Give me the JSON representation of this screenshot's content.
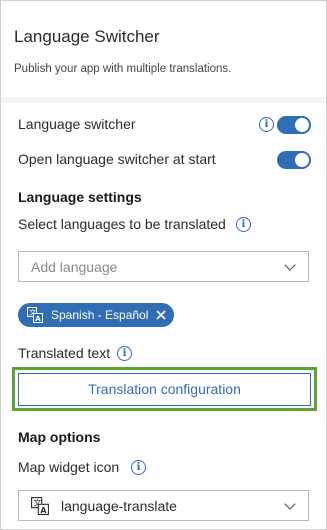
{
  "header": {
    "title": "Language Switcher",
    "subtitle": "Publish your app with multiple translations."
  },
  "settings": {
    "language_switcher_label": "Language switcher",
    "language_switcher_on": true,
    "open_at_start_label": "Open language switcher at start",
    "open_at_start_on": true
  },
  "language_settings": {
    "title": "Language settings",
    "select_label": "Select languages to be translated",
    "add_language_placeholder": "Add language",
    "chips": [
      {
        "label": "Spanish - Español"
      }
    ],
    "translated_text_label": "Translated text",
    "config_button_label": "Translation configuration"
  },
  "map_options": {
    "title": "Map options",
    "widget_icon_label": "Map widget icon",
    "widget_icon_value": "language-translate"
  },
  "colors": {
    "accent": "#2f6db5",
    "highlight": "#5aa531"
  }
}
